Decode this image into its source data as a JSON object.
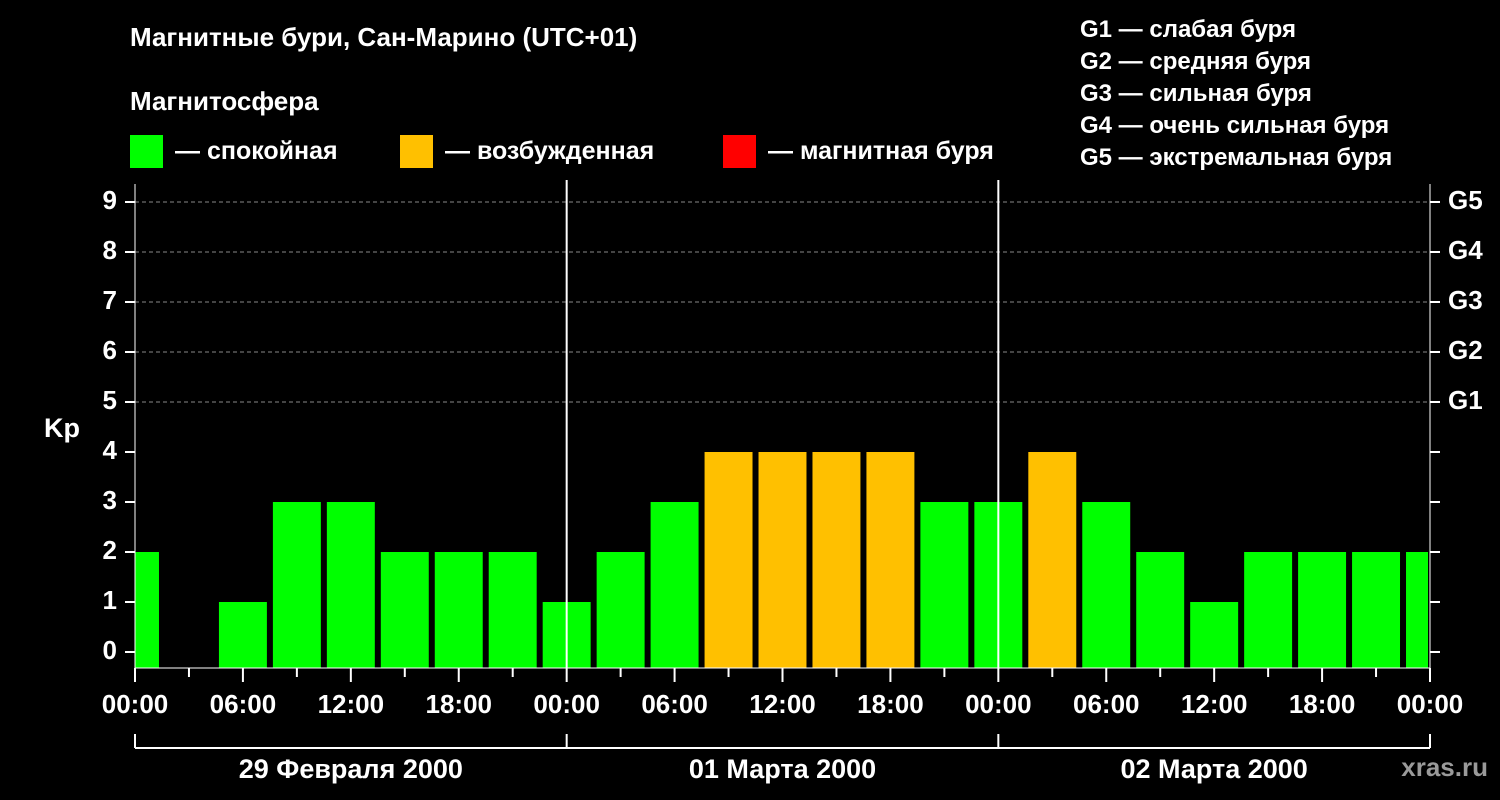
{
  "title": "Магнитные бури, Сан-Марино (UTC+01)",
  "subtitle": "Магнитосфера",
  "legend": [
    {
      "label": "— спокойная",
      "color": "#00ff00"
    },
    {
      "label": "— возбужденная",
      "color": "#ffc000"
    },
    {
      "label": "— магнитная буря",
      "color": "#ff0000"
    }
  ],
  "g_scale": [
    "G1 — слабая буря",
    "G2 — средняя буря",
    "G3 — сильная буря",
    "G4 — очень сильная буря",
    "G5 — экстремальная буря"
  ],
  "source": "xras.ru",
  "chart_data": {
    "type": "bar",
    "ylabel": "Kp",
    "ylim": [
      0,
      9
    ],
    "y_ticks": [
      "0",
      "1",
      "2",
      "3",
      "4",
      "5",
      "6",
      "7",
      "8",
      "9"
    ],
    "right_ticks": [
      {
        "value": 5,
        "label": "G1"
      },
      {
        "value": 6,
        "label": "G2"
      },
      {
        "value": 7,
        "label": "G3"
      },
      {
        "value": 8,
        "label": "G4"
      },
      {
        "value": 9,
        "label": "G5"
      }
    ],
    "x_tick_labels": [
      "00:00",
      "06:00",
      "12:00",
      "18:00",
      "00:00",
      "06:00",
      "12:00",
      "18:00",
      "00:00",
      "06:00",
      "12:00",
      "18:00",
      "00:00"
    ],
    "days": [
      "29 Февраля 2000",
      "01 Марта 2000",
      "02 Марта 2000"
    ],
    "interval_hours": 3,
    "start_hour_offset": 0,
    "values": [
      2,
      0,
      1,
      3,
      3,
      2,
      2,
      2,
      1,
      2,
      3,
      4,
      4,
      4,
      4,
      3,
      3,
      4,
      3,
      2,
      1,
      2,
      2,
      2,
      2
    ],
    "thresholds": {
      "quiet_max": 3,
      "active_max": 4
    },
    "colors": {
      "quiet": "#00ff00",
      "active": "#ffc000",
      "storm": "#ff0000"
    },
    "grid": true
  }
}
